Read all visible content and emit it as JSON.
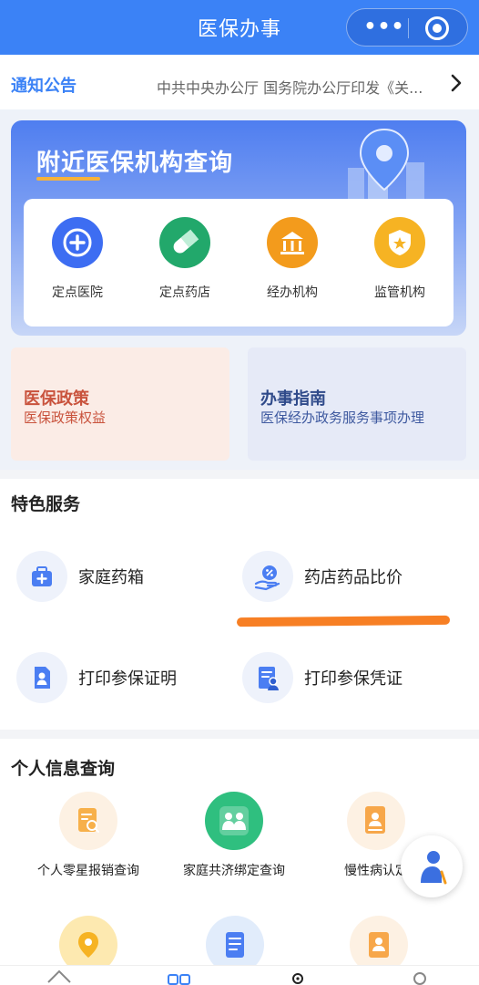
{
  "header": {
    "title": "医保办事",
    "more_icon": "more-dots-icon",
    "close_icon": "target-icon"
  },
  "notice": {
    "tag": "通知公告",
    "text": "中共中央办公厅 国务院办公厅印发《关...",
    "chevron": "›"
  },
  "nearby": {
    "title": "附近医保机构查询",
    "items": [
      {
        "label": "定点医院",
        "icon": "hospital-plus-icon",
        "color": "#3d6df2"
      },
      {
        "label": "定点药店",
        "icon": "pill-icon",
        "color": "#22a86b"
      },
      {
        "label": "经办机构",
        "icon": "bank-icon",
        "color": "#f39b1c"
      },
      {
        "label": "监管机构",
        "icon": "shield-star-icon",
        "color": "#f6b323"
      }
    ]
  },
  "tiles": {
    "policy": {
      "title": "医保政策",
      "subtitle": "医保政策权益"
    },
    "guide": {
      "title": "办事指南",
      "subtitle": "医保经办政务服务事项办理"
    }
  },
  "featured": {
    "title": "特色服务",
    "items": [
      {
        "label": "家庭药箱",
        "icon": "medicine-box-icon"
      },
      {
        "label": "药店药品比价",
        "icon": "price-compare-icon"
      },
      {
        "label": "打印参保证明",
        "icon": "print-certificate-icon"
      },
      {
        "label": "打印参保凭证",
        "icon": "print-voucher-icon"
      }
    ]
  },
  "personal": {
    "title": "个人信息查询",
    "items": [
      {
        "label": "个人零星报销查询",
        "icon": "reimbursement-search-icon",
        "color": "#f7b04a"
      },
      {
        "label": "家庭共济绑定查询",
        "icon": "family-icon",
        "color": "#2fbf7f"
      },
      {
        "label": "慢性病认定",
        "icon": "chronic-disease-icon",
        "color": "#f7a74a"
      }
    ]
  },
  "colors": {
    "primary": "#3b82f6",
    "accent_orange": "#f77f24",
    "policy_red": "#c9533d",
    "guide_blue": "#2f4a8a"
  }
}
